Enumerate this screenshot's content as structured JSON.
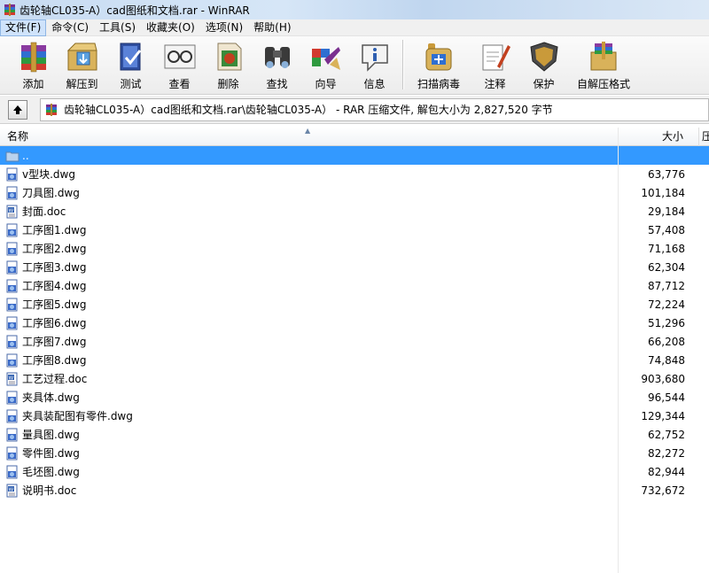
{
  "window": {
    "title": "齿轮轴CL035-A）cad图纸和文档.rar - WinRAR"
  },
  "menu": [
    {
      "label": "文件(F)",
      "active": true
    },
    {
      "label": "命令(C)"
    },
    {
      "label": "工具(S)"
    },
    {
      "label": "收藏夹(O)"
    },
    {
      "label": "选项(N)"
    },
    {
      "label": "帮助(H)"
    }
  ],
  "toolbar": {
    "add": "添加",
    "extract": "解压到",
    "test": "测试",
    "view": "查看",
    "delete": "删除",
    "find": "查找",
    "wizard": "向导",
    "info": "信息",
    "virus_scan": "扫描病毒",
    "comment": "注释",
    "protect": "保护",
    "sfx": "自解压格式"
  },
  "address": {
    "text": "齿轮轴CL035-A）cad图纸和文档.rar\\齿轮轴CL035-A）  - RAR 压缩文件, 解包大小为 2,827,520 字节"
  },
  "columns": {
    "name": "名称",
    "size": "大小",
    "packed": "压"
  },
  "files": [
    {
      "name": "..",
      "size": "",
      "type": "folder"
    },
    {
      "name": "v型块.dwg",
      "size": "63,776",
      "type": "dwg"
    },
    {
      "name": "刀具图.dwg",
      "size": "101,184",
      "type": "dwg"
    },
    {
      "name": "封面.doc",
      "size": "29,184",
      "type": "doc"
    },
    {
      "name": "工序图1.dwg",
      "size": "57,408",
      "type": "dwg"
    },
    {
      "name": "工序图2.dwg",
      "size": "71,168",
      "type": "dwg"
    },
    {
      "name": "工序图3.dwg",
      "size": "62,304",
      "type": "dwg"
    },
    {
      "name": "工序图4.dwg",
      "size": "87,712",
      "type": "dwg"
    },
    {
      "name": "工序图5.dwg",
      "size": "72,224",
      "type": "dwg"
    },
    {
      "name": "工序图6.dwg",
      "size": "51,296",
      "type": "dwg"
    },
    {
      "name": "工序图7.dwg",
      "size": "66,208",
      "type": "dwg"
    },
    {
      "name": "工序图8.dwg",
      "size": "74,848",
      "type": "dwg"
    },
    {
      "name": "工艺过程.doc",
      "size": "903,680",
      "type": "doc"
    },
    {
      "name": "夹具体.dwg",
      "size": "96,544",
      "type": "dwg"
    },
    {
      "name": "夹具装配图有零件.dwg",
      "size": "129,344",
      "type": "dwg"
    },
    {
      "name": "量具图.dwg",
      "size": "62,752",
      "type": "dwg"
    },
    {
      "name": "零件图.dwg",
      "size": "82,272",
      "type": "dwg"
    },
    {
      "name": "毛坯图.dwg",
      "size": "82,944",
      "type": "dwg"
    },
    {
      "name": "说明书.doc",
      "size": "732,672",
      "type": "doc"
    }
  ]
}
